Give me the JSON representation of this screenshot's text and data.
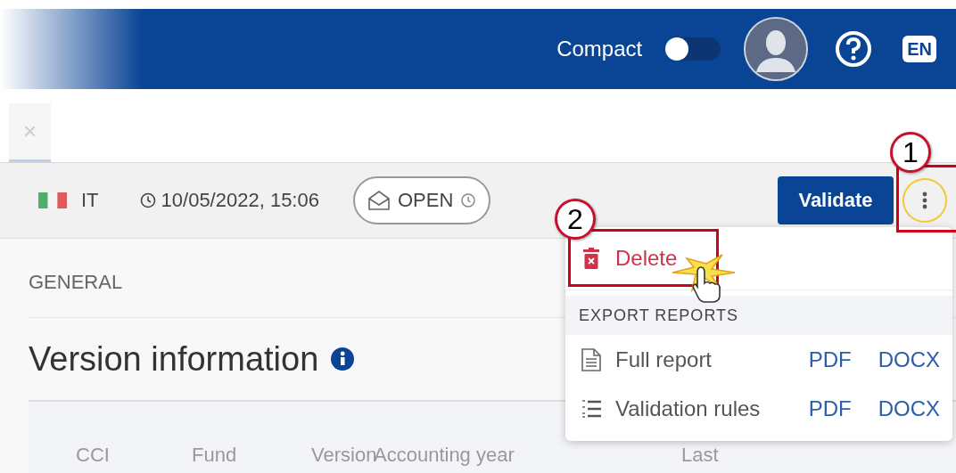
{
  "header": {
    "compact_label": "Compact",
    "compact_on": false,
    "language": "EN"
  },
  "tabs": [
    {
      "label": "×",
      "selected": true
    }
  ],
  "toolbar": {
    "country": "IT",
    "datetime": "10/05/2022, 15:06",
    "status": "OPEN",
    "validate": "Validate"
  },
  "section": "GENERAL",
  "title": "Version information",
  "table": {
    "columns": [
      "CCI",
      "Fund",
      "Version",
      "Accounting year",
      "Last"
    ]
  },
  "menu": {
    "delete": "Delete",
    "section": "EXPORT REPORTS",
    "reports": [
      {
        "kind": "document",
        "label": "Full report",
        "formats": [
          "PDF",
          "DOCX"
        ]
      },
      {
        "kind": "list",
        "label": "Validation rules",
        "formats": [
          "PDF",
          "DOCX"
        ]
      }
    ]
  },
  "callouts": [
    "1",
    "2"
  ]
}
